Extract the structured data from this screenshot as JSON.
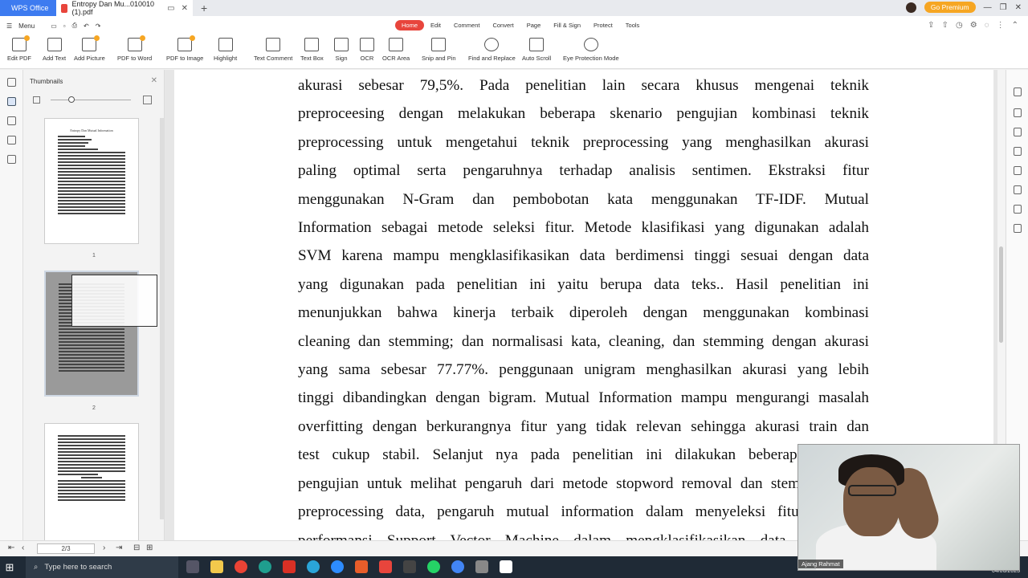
{
  "tabs": {
    "app": "WPS Office",
    "doc": "Entropy Dan Mu...010010 (1).pdf",
    "premium": "Go Premium"
  },
  "menu": {
    "label": "Menu",
    "tabs": [
      "Home",
      "Edit",
      "Comment",
      "Convert",
      "Page",
      "Fill & Sign",
      "Protect",
      "Tools"
    ]
  },
  "toolbar": {
    "items": [
      "Edit PDF",
      "Add Text",
      "Add Picture",
      "PDF to Word",
      "PDF to Image",
      "Highlight",
      "Text Comment",
      "Text Box",
      "Sign",
      "OCR",
      "OCR Area",
      "Snip and Pin",
      "Find and Replace",
      "Auto Scroll",
      "Eye Protection Mode"
    ]
  },
  "thumbnails": {
    "title": "Thumbnails",
    "page1_num": "1",
    "page2_num": "2",
    "page1_title": "Entropy Dan Mutual Information"
  },
  "document": {
    "lines": [
      "akurasi sebesar 79,5%. Pada penelitian lain secara khusus mengenai teknik",
      "preproceesing dengan melakukan beberapa skenario pengujian kombinasi teknik",
      "preprocessing untuk mengetahui teknik preprocessing yang menghasilkan akurasi",
      "paling optimal serta pengaruhnya terhadap analisis sentimen. Ekstraksi fitur",
      "menggunakan N-Gram dan pembobotan kata menggunakan TF-IDF. Mutual",
      "Information sebagai metode seleksi fitur. Metode klasifikasi yang digunakan adalah",
      "SVM karena mampu mengklasifikasikan data berdimensi tinggi sesuai dengan data",
      "yang digunakan pada penelitian ini yaitu berupa data teks.. Hasil penelitian ini",
      "menunjukkan bahwa kinerja terbaik diperoleh dengan menggunakan kombinasi",
      "cleaning dan stemming; dan normalisasi kata, cleaning, dan stemming dengan akurasi",
      "yang sama sebesar 77.77%. penggunaan unigram menghasilkan akurasi yang lebih",
      "tinggi dibandingkan dengan bigram. Mutual Information mampu mengurangi masalah",
      "overfitting dengan berkurangnya fitur yang tidak relevan sehingga akurasi train dan",
      "test cukup stabil. Selanjut nya pada penelitian ini dilakukan beberapa skenario",
      "pengujian untuk melihat pengaruh dari metode stopword removal dan stemming pada",
      "preprocessing data, pengaruh mutual information dalam menyeleksi fitur terhadap",
      "performansi Support Vector Machine dalam mengklasifikasikan data berdimensi"
    ]
  },
  "status": {
    "page": "2/3"
  },
  "taskbar": {
    "search": "Type here to search",
    "date": "04/06/2023"
  },
  "webcam": {
    "name": "Ajang Rahmat"
  }
}
